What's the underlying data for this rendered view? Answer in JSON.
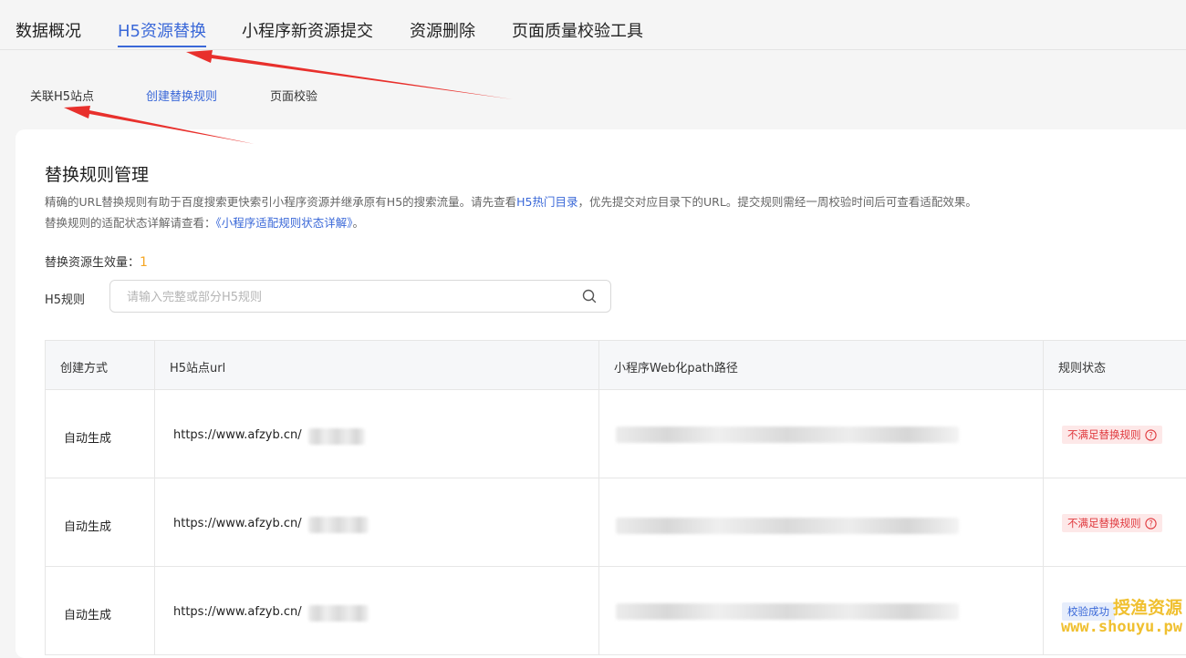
{
  "top_tabs": [
    "数据概况",
    "H5资源替换",
    "小程序新资源提交",
    "资源删除",
    "页面质量校验工具"
  ],
  "sub_tabs": [
    "关联H5站点",
    "创建替换规则",
    "页面校验"
  ],
  "card": {
    "title": "替换规则管理",
    "desc_line1_a": "精确的URL替换规则有助于百度搜索更快索引小程序资源并继承原有H5的搜索流量。请先查看",
    "desc_line1_link": "H5热门目录",
    "desc_line1_b": "，优先提交对应目录下的URL。提交规则需经一周校验时间后可查看适配效果。",
    "desc_line2_a": "替换规则的适配状态详解请查看：",
    "desc_line2_link": "《小程序适配规则状态详解》",
    "desc_line2_b": "。",
    "count_label": "替换资源生效量：",
    "count_value": "1"
  },
  "search": {
    "label": "H5规则",
    "placeholder": "请输入完整或部分H5规则"
  },
  "table": {
    "headers": [
      "创建方式",
      "H5站点url",
      "小程序Web化path路径",
      "规则状态"
    ],
    "rows": [
      {
        "method": "自动生成",
        "url": "https://www.afzyb.cn/",
        "status": "不满足替换规则",
        "status_type": "fail"
      },
      {
        "method": "自动生成",
        "url": "https://www.afzyb.cn/",
        "status": "不满足替换规则",
        "status_type": "fail"
      },
      {
        "method": "自动生成",
        "url": "https://www.afzyb.cn/",
        "status": "校验成功",
        "status_type": "ok"
      }
    ]
  },
  "watermark": {
    "line1": "授渔资源",
    "line2": "www.shouyu.pw"
  },
  "colors": {
    "accent": "#3a68d8",
    "count": "#f5a623",
    "fail": "#e0393e",
    "arrow": "#e8302c"
  }
}
